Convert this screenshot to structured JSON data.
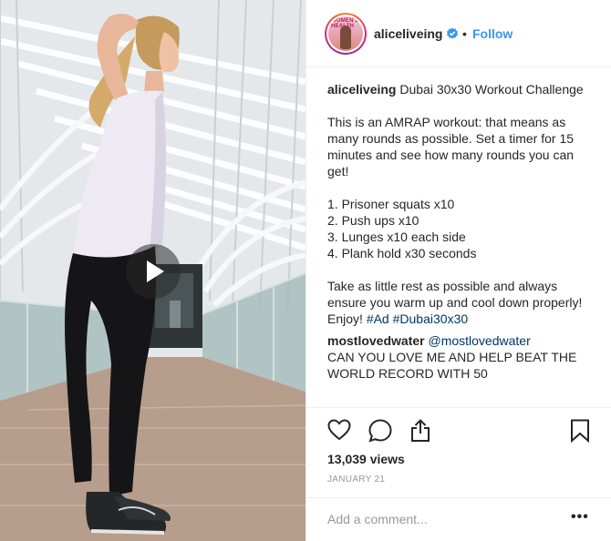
{
  "header": {
    "username": "aliceliveing",
    "separator": "•",
    "follow_label": "Follow"
  },
  "caption": {
    "username": "aliceliveing",
    "title": " Dubai 30x30 Workout Challenge",
    "intro": "This is an AMRAP workout: that means as many rounds as possible. Set a timer for 15 minutes and see how many rounds you can get!",
    "steps": [
      "1. Prisoner squats x10",
      "2. Push ups x10",
      "3. Lunges x10 each side",
      "4. Plank hold x30 seconds"
    ],
    "outro": "Take as little rest as possible and always ensure you warm up and cool down properly!",
    "enjoy": "Enjoy! ",
    "hashtags": [
      "#Ad",
      "#Dubai30x30"
    ]
  },
  "comment": {
    "username": "mostlovedwater",
    "handle": "@mostlovedwater",
    "text": "CAN YOU LOVE ME AND HELP BEAT THE WORLD RECORD WITH 50"
  },
  "stats": {
    "views": "13,039 views",
    "date": "JANUARY 21"
  },
  "add_comment": {
    "placeholder": "Add a comment...",
    "more_label": "•••"
  },
  "avatar": {
    "magazine_text": "WOMEN'S HEALTH"
  },
  "icons": {
    "like": "heart-icon",
    "comment": "comment-icon",
    "share": "share-icon",
    "save": "bookmark-icon",
    "play": "play-icon",
    "verified": "verified-badge-icon"
  },
  "colors": {
    "link": "#3897f0",
    "hashtag": "#003569",
    "muted": "#999999",
    "text": "#262626"
  }
}
